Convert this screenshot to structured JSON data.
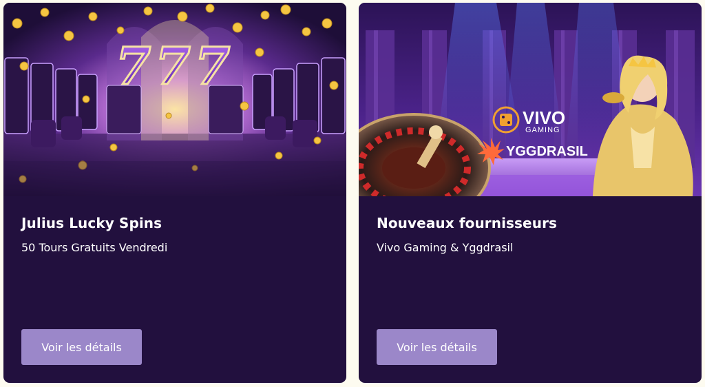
{
  "cards": [
    {
      "title": "Julius Lucky Spins",
      "subtitle": "50 Tours Gratuits Vendredi",
      "button_label": "Voir les détails",
      "image_text": "777"
    },
    {
      "title": "Nouveaux fournisseurs",
      "subtitle": "Vivo Gaming & Yggdrasil",
      "button_label": "Voir les détails",
      "logos": {
        "vivo_line1": "VIVO",
        "vivo_line2": "GAMING",
        "yggdrasil": "YGGDRASIL"
      }
    }
  ],
  "colors": {
    "page_background": "#fdfbf0",
    "card_background": "#22103e",
    "button_background": "#9b87c9",
    "text": "#ffffff",
    "gold": "#f5c542"
  }
}
